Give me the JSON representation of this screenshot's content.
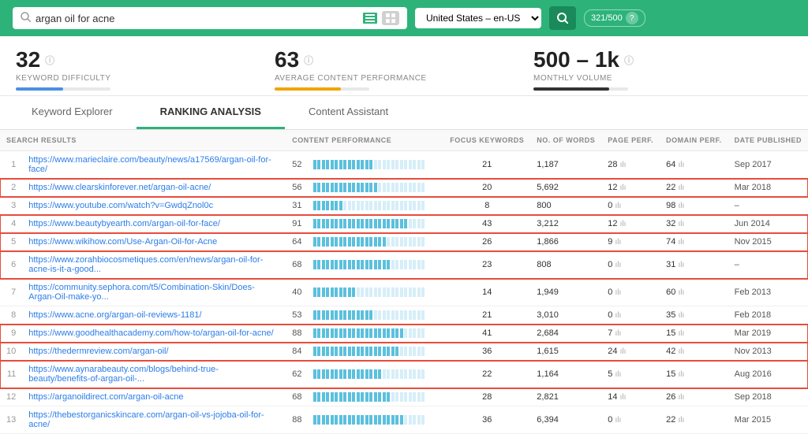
{
  "header": {
    "search_query": "argan oil for acne",
    "search_placeholder": "argan oil for acne",
    "location": "United States – en-US",
    "counter": "321/500",
    "help_icon": "?"
  },
  "metrics": [
    {
      "value": "32",
      "label": "KEYWORD DIFFICULTY",
      "info": "ⓘ",
      "progress": 50,
      "color": "blue"
    },
    {
      "value": "63",
      "label": "AVERAGE CONTENT PERFORMANCE",
      "info": "ⓘ",
      "progress": 70,
      "color": "orange"
    },
    {
      "value": "500 – 1k",
      "label": "MONTHLY VOLUME",
      "info": "ⓘ",
      "progress": 80,
      "color": "dark"
    }
  ],
  "tabs": [
    {
      "label": "Keyword Explorer",
      "active": false
    },
    {
      "label": "RANKING ANALYSIS",
      "active": true
    },
    {
      "label": "Content Assistant",
      "active": false
    }
  ],
  "table": {
    "columns": [
      "SEARCH RESULTS",
      "CONTENT PERFORMANCE",
      "FOCUS KEYWORDS",
      "NO. OF WORDS",
      "PAGE PERF.",
      "DOMAIN PERF.",
      "DATE PUBLISHED"
    ],
    "rows": [
      {
        "num": 1,
        "url": "https://www.marieclaire.com/beauty/news/a17569/argan-oil-for-face/",
        "score": 52,
        "bars": 14,
        "focus": 21,
        "words": "1,187",
        "page": 28,
        "domain": 64,
        "date": "Sep 2017",
        "highlight": false
      },
      {
        "num": 2,
        "url": "https://www.clearskinforever.net/argan-oil-acne/",
        "score": 56,
        "bars": 15,
        "focus": 20,
        "words": "5,692",
        "page": 12,
        "domain": 22,
        "date": "Mar 2018",
        "highlight": true
      },
      {
        "num": 3,
        "url": "https://www.youtube.com/watch?v=GwdqZnol0c",
        "score": 31,
        "bars": 7,
        "focus": 8,
        "words": "800",
        "page": 0,
        "domain": 98,
        "date": "–",
        "highlight": false
      },
      {
        "num": 4,
        "url": "https://www.beautybyearth.com/argan-oil-for-face/",
        "score": 91,
        "bars": 22,
        "focus": 43,
        "words": "3,212",
        "page": 12,
        "domain": 32,
        "date": "Jun 2014",
        "highlight": true
      },
      {
        "num": 5,
        "url": "https://www.wikihow.com/Use-Argan-Oil-for-Acne",
        "score": 64,
        "bars": 17,
        "focus": 26,
        "words": "1,866",
        "page": 9,
        "domain": 74,
        "date": "Nov 2015",
        "highlight": true
      },
      {
        "num": 6,
        "url": "https://www.zorahbiocosmetiques.com/en/news/argan-oil-for-acne-is-it-a-good...",
        "score": 68,
        "bars": 18,
        "focus": 23,
        "words": "808",
        "page": 0,
        "domain": 31,
        "date": "–",
        "highlight": true
      },
      {
        "num": 7,
        "url": "https://community.sephora.com/t5/Combination-Skin/Does-Argan-Oil-make-yo...",
        "score": 40,
        "bars": 10,
        "focus": 14,
        "words": "1,949",
        "page": 0,
        "domain": 60,
        "date": "Feb 2013",
        "highlight": false
      },
      {
        "num": 8,
        "url": "https://www.acne.org/argan-oil-reviews-1181/",
        "score": 53,
        "bars": 14,
        "focus": 21,
        "words": "3,010",
        "page": 0,
        "domain": 35,
        "date": "Feb 2018",
        "highlight": false
      },
      {
        "num": 9,
        "url": "https://www.goodhealthacademy.com/how-to/argan-oil-for-acne/",
        "score": 88,
        "bars": 21,
        "focus": 41,
        "words": "2,684",
        "page": 7,
        "domain": 15,
        "date": "Mar 2019",
        "highlight": true
      },
      {
        "num": 10,
        "url": "https://thedermreview.com/argan-oil/",
        "score": 84,
        "bars": 20,
        "focus": 36,
        "words": "1,615",
        "page": 24,
        "domain": 42,
        "date": "Nov 2013",
        "highlight": true
      },
      {
        "num": 11,
        "url": "https://www.aynarabeauty.com/blogs/behind-true-beauty/benefits-of-argan-oil-...",
        "score": 62,
        "bars": 16,
        "focus": 22,
        "words": "1,164",
        "page": 5,
        "domain": 15,
        "date": "Aug 2016",
        "highlight": true
      },
      {
        "num": 12,
        "url": "https://arganoildirect.com/argan-oil-acne",
        "score": 68,
        "bars": 18,
        "focus": 28,
        "words": "2,821",
        "page": 14,
        "domain": 26,
        "date": "Sep 2018",
        "highlight": false
      },
      {
        "num": 13,
        "url": "https://thebestorganicskincare.com/argan-oil-vs-jojoba-oil-for-acne/",
        "score": 88,
        "bars": 21,
        "focus": 36,
        "words": "6,394",
        "page": 0,
        "domain": 22,
        "date": "Mar 2015",
        "highlight": false
      }
    ]
  }
}
